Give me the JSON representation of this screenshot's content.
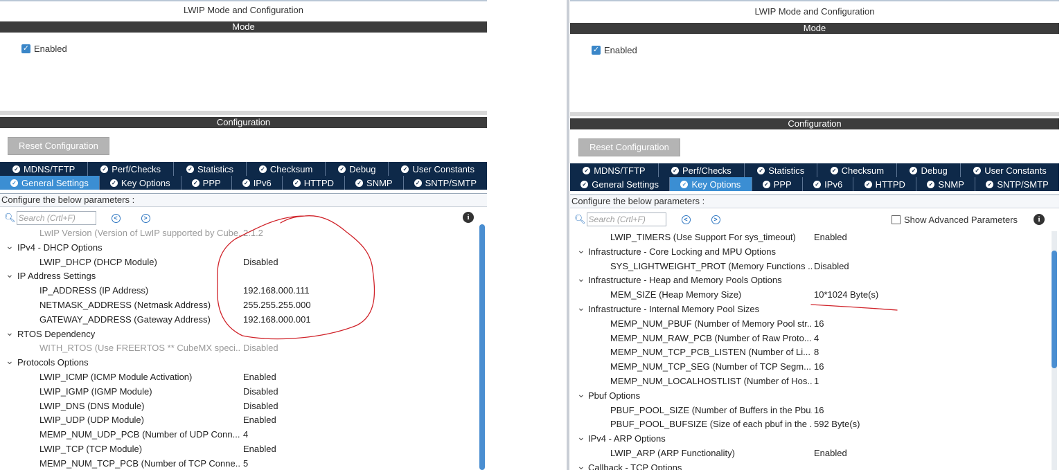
{
  "left": {
    "title": "LWIP Mode and Configuration",
    "mode_bar": "Mode",
    "enabled_label": "Enabled",
    "config_bar": "Configuration",
    "reset_label": "Reset Configuration",
    "tabs_row1": [
      "MDNS/TFTP",
      "Perf/Checks",
      "Statistics",
      "Checksum",
      "Debug",
      "User Constants"
    ],
    "tabs_row2": [
      "General Settings",
      "Key Options",
      "PPP",
      "IPv6",
      "HTTPD",
      "SNMP",
      "SNTP/SMTP"
    ],
    "active_tab": "General Settings",
    "hint": "Configure the below parameters :",
    "search_placeholder": "Search (Crtl+F)",
    "rows": [
      {
        "type": "param",
        "label": "LwIP Version (Version of LwIP supported by Cube...",
        "value": "2.1.2",
        "dim": true
      },
      {
        "type": "group",
        "label": "IPv4 - DHCP Options"
      },
      {
        "type": "param",
        "label": "LWIP_DHCP (DHCP Module)",
        "value": "Disabled"
      },
      {
        "type": "group",
        "label": "IP Address Settings"
      },
      {
        "type": "param",
        "label": "IP_ADDRESS (IP Address)",
        "value": "192.168.000.111"
      },
      {
        "type": "param",
        "label": "NETMASK_ADDRESS (Netmask Address)",
        "value": "255.255.255.000"
      },
      {
        "type": "param",
        "label": "GATEWAY_ADDRESS (Gateway Address)",
        "value": "192.168.000.001"
      },
      {
        "type": "group",
        "label": "RTOS Dependency"
      },
      {
        "type": "param",
        "label": "WITH_RTOS (Use FREERTOS ** CubeMX speci...",
        "value": "Disabled",
        "dim": true
      },
      {
        "type": "group",
        "label": "Protocols Options"
      },
      {
        "type": "param",
        "label": "LWIP_ICMP (ICMP Module Activation)",
        "value": "Enabled"
      },
      {
        "type": "param",
        "label": "LWIP_IGMP (IGMP Module)",
        "value": "Disabled"
      },
      {
        "type": "param",
        "label": "LWIP_DNS (DNS Module)",
        "value": "Disabled"
      },
      {
        "type": "param",
        "label": "LWIP_UDP (UDP Module)",
        "value": "Enabled"
      },
      {
        "type": "param",
        "label": "MEMP_NUM_UDP_PCB (Number of UDP Conn...",
        "value": "4"
      },
      {
        "type": "param",
        "label": "LWIP_TCP (TCP Module)",
        "value": "Enabled"
      },
      {
        "type": "param",
        "label": "MEMP_NUM_TCP_PCB (Number of TCP Conne...",
        "value": "5"
      }
    ]
  },
  "right": {
    "title": "LWIP Mode and Configuration",
    "mode_bar": "Mode",
    "enabled_label": "Enabled",
    "config_bar": "Configuration",
    "reset_label": "Reset Configuration",
    "tabs_row1": [
      "MDNS/TFTP",
      "Perf/Checks",
      "Statistics",
      "Checksum",
      "Debug",
      "User Constants"
    ],
    "tabs_row2": [
      "General Settings",
      "Key Options",
      "PPP",
      "IPv6",
      "HTTPD",
      "SNMP",
      "SNTP/SMTP"
    ],
    "active_tab": "Key Options",
    "hint": "Configure the below parameters :",
    "search_placeholder": "Search (Crtl+F)",
    "advanced_label": "Show Advanced Parameters",
    "rows": [
      {
        "type": "param",
        "label": "LWIP_TIMERS (Use Support For sys_timeout)",
        "value": "Enabled"
      },
      {
        "type": "group",
        "label": "Infrastructure - Core Locking and MPU Options"
      },
      {
        "type": "param",
        "label": "SYS_LIGHTWEIGHT_PROT (Memory Functions ...",
        "value": "Disabled"
      },
      {
        "type": "group",
        "label": "Infrastructure - Heap and Memory Pools Options"
      },
      {
        "type": "param",
        "label": "MEM_SIZE (Heap Memory Size)",
        "value": "10*1024 Byte(s)"
      },
      {
        "type": "group",
        "label": "Infrastructure - Internal Memory Pool Sizes"
      },
      {
        "type": "param",
        "label": "MEMP_NUM_PBUF (Number of Memory Pool str...",
        "value": "16"
      },
      {
        "type": "param",
        "label": "MEMP_NUM_RAW_PCB (Number of Raw Proto...",
        "value": "4"
      },
      {
        "type": "param",
        "label": "MEMP_NUM_TCP_PCB_LISTEN (Number of Li...",
        "value": "8"
      },
      {
        "type": "param",
        "label": "MEMP_NUM_TCP_SEG (Number of TCP Segm...",
        "value": "16"
      },
      {
        "type": "param",
        "label": "MEMP_NUM_LOCALHOSTLIST (Number of Hos...",
        "value": "1"
      },
      {
        "type": "group",
        "label": "Pbuf Options"
      },
      {
        "type": "param",
        "label": "PBUF_POOL_SIZE (Number of Buffers in the Pbu...",
        "value": "16"
      },
      {
        "type": "param",
        "label": "PBUF_POOL_BUFSIZE (Size of each pbuf in the ...",
        "value": "592 Byte(s)"
      },
      {
        "type": "group",
        "label": "IPv4 - ARP Options"
      },
      {
        "type": "param",
        "label": "LWIP_ARP (ARP Functionality)",
        "value": "Enabled"
      },
      {
        "type": "group",
        "label": "Callback - TCP Options"
      }
    ]
  },
  "colors": {
    "header_bar": "#3c3c3c",
    "tab_bg": "#0e2949",
    "tab_active": "#3b8ed3",
    "annotation": "#d0232a"
  }
}
